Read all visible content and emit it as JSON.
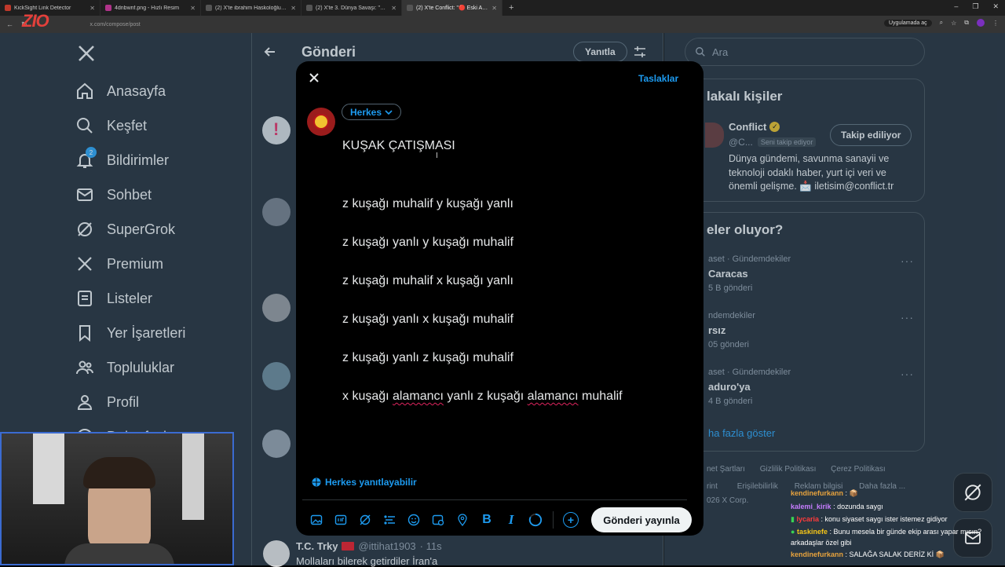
{
  "browser": {
    "tabs": [
      {
        "title": "KickSight Link Detector",
        "color": "#c0392b"
      },
      {
        "title": "4dnbwnf.png - Hızlı Resim",
        "color": "#b0338a"
      },
      {
        "title": "(2) X'te ibrahim Haskoloğlu: \"V...",
        "color": "#555"
      },
      {
        "title": "(2) X'te 3. Dünya Savaşı: \"🔴 So",
        "color": "#555"
      },
      {
        "title": "(2) X'te Conflict: \"🔴 Eski ABD",
        "color": "#555",
        "active": true
      }
    ],
    "url": "x.com/compose/post",
    "extension_label": "Uygulamada aç"
  },
  "sidebar": {
    "items": [
      {
        "label": "Anasayfa",
        "icon": "home-icon"
      },
      {
        "label": "Keşfet",
        "icon": "search-icon"
      },
      {
        "label": "Bildirimler",
        "icon": "bell-icon",
        "badge": "2"
      },
      {
        "label": "Sohbet",
        "icon": "mail-icon"
      },
      {
        "label": "SuperGrok",
        "icon": "grok-icon"
      },
      {
        "label": "Premium",
        "icon": "x-icon"
      },
      {
        "label": "Listeler",
        "icon": "list-icon"
      },
      {
        "label": "Yer İşaretleri",
        "icon": "bookmark-icon"
      },
      {
        "label": "Topluluklar",
        "icon": "people-icon"
      },
      {
        "label": "Profil",
        "icon": "person-icon"
      },
      {
        "label": "Daha fazla",
        "icon": "more-icon"
      }
    ]
  },
  "main": {
    "title": "Gönderi",
    "reply_button": "Yanıtla",
    "bottom_tweet": {
      "name": "T.C. Trky",
      "handle": "@ittihat1903",
      "time": "· 11s",
      "text": "Mollaları bilerek getirdiler İran'a"
    }
  },
  "right": {
    "search_placeholder": "Ara",
    "related_title": "lakalı kişiler",
    "related_user": {
      "name": "Conflict",
      "handle": "@C...",
      "follows_you": "Seni takip ediyor",
      "follow_button": "Takip ediliyor",
      "bio": [
        "Dünya gündemi, savunma sanayii ve",
        "teknoloji odaklı haber, yurt içi veri ve",
        "önemli gelişme. 📩 iletisim@conflict.tr"
      ]
    },
    "trends_title": "eler oluyor?",
    "trends": [
      {
        "category": "aset · Gündemdekiler",
        "name": "Caracas",
        "count": "5 B gönderi"
      },
      {
        "category": "ndemdekiler",
        "name": "rsız",
        "count": "05 gönderi"
      },
      {
        "category": "aset · Gündemdekiler",
        "name": "aduro'ya",
        "count": "4 B gönderi"
      }
    ],
    "show_more": "ha fazla göster",
    "footer": [
      "net Şartları",
      "Gizlilik Politikası",
      "Çerez Politikası",
      "rint",
      "Erişilebilirlik",
      "Reklam bilgisi",
      "Daha fazla ...",
      "026 X Corp."
    ]
  },
  "modal": {
    "drafts": "Taslaklar",
    "audience": "Herkes",
    "lines": [
      "KUŞAK ÇATIŞMASI",
      "z kuşağı muhalif y kuşağı yanlı",
      "z kuşağı yanlı y kuşağı muhalif",
      "z kuşağı muhalif x kuşağı yanlı",
      "z kuşağı yanlı x kuşağı muhalif",
      "z kuşağı yanlı z kuşağı muhalif"
    ],
    "last_line": {
      "a": "x kuşağı ",
      "b": "alamancı",
      "c": " yanlı z kuşağı ",
      "d": "alamancı",
      "e": " muhalif"
    },
    "reply_setting": "Herkes yanıtlayabilir",
    "post_button": "Gönderi yayınla"
  },
  "chat": [
    {
      "user": "kendinefurkann",
      "color": "#e8a33d",
      "msg": ": 📦"
    },
    {
      "user": "kalemi_kirik",
      "color": "#c77dff",
      "msg": ": dozunda saygı"
    },
    {
      "user": "lycaria",
      "color": "#ff3b3b",
      "msg": ": konu siyaset saygı ister istemez gidiyor"
    },
    {
      "user": "taskinefe",
      "color": "#f5c518",
      "msg": ": Bunu mesela bir günde ekip arası yapar mısın? arkadaşlar özel gibi"
    },
    {
      "user": "kendinefurkann",
      "color": "#e8a33d",
      "msg": ": SALAĞA SALAK DERİZ Kİ 📦"
    }
  ],
  "stream_logo": "ZIO"
}
